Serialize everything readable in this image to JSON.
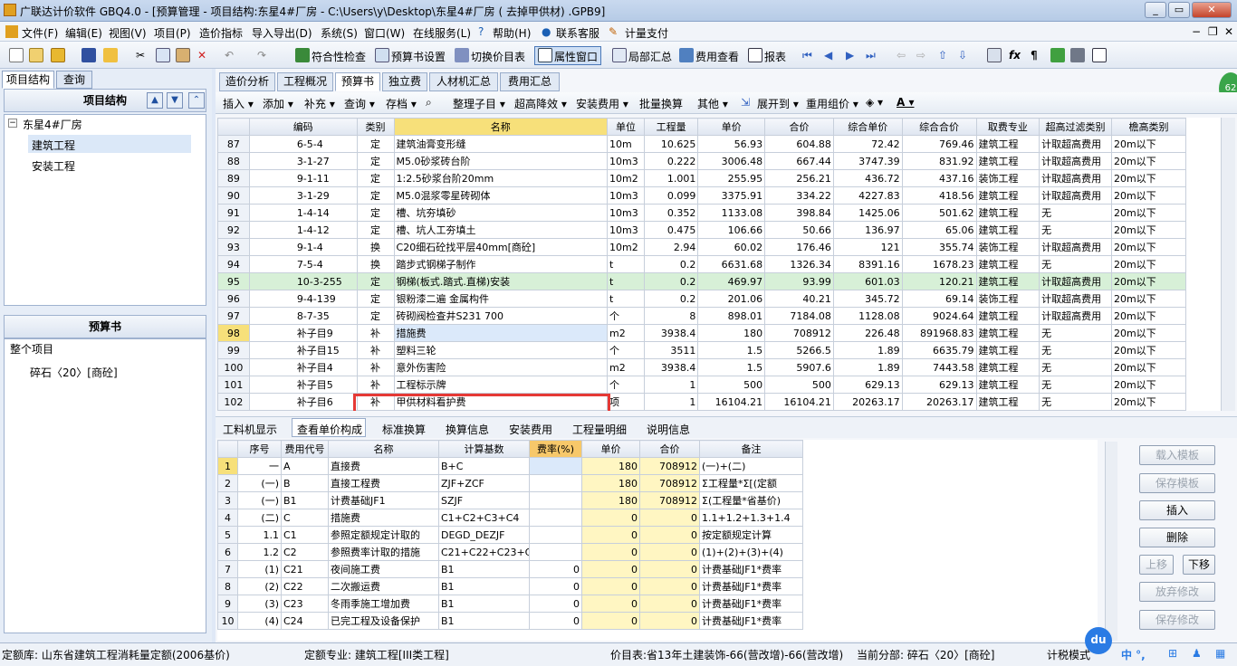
{
  "window": {
    "title": "广联达计价软件 GBQ4.0 - [预算管理 - 项目结构:东星4#厂房 - C:\\Users\\y\\Desktop\\东星4#厂房 ( 去掉甲供材) .GPB9]"
  },
  "menu": [
    "文件(F)",
    "编辑(E)",
    "视图(V)",
    "项目(P)",
    "造价指标",
    "导入导出(D)",
    "系统(S)",
    "窗口(W)",
    "在线服务(L)",
    "帮助(H)",
    "联系客服",
    "计量支付"
  ],
  "toolbar": {
    "check": "符合性检查",
    "budget_settings": "预算书设置",
    "switch_price": "切换价目表",
    "property_window": "属性窗口",
    "local_summary": "局部汇总",
    "fee_view": "费用查看",
    "report": "报表"
  },
  "left": {
    "tabs": [
      "项目结构",
      "查询"
    ],
    "structure_title": "项目结构",
    "tree": [
      "东星4#厂房",
      "建筑工程",
      "安装工程"
    ],
    "budget_title": "预算书",
    "budget_tree": [
      "整个项目",
      "碎石〈20〉[商砼]"
    ]
  },
  "main": {
    "tabs": [
      "造价分析",
      "工程概况",
      "预算书",
      "独立费",
      "人材机汇总",
      "费用汇总"
    ],
    "subtoolbar": [
      "插入",
      "添加",
      "补充",
      "查询",
      "存档",
      "整理子目",
      "超高降效",
      "安装费用",
      "批量换算",
      "其他",
      "展开到",
      "重用组价"
    ],
    "headers": [
      "编码",
      "类别",
      "名称",
      "单位",
      "工程量",
      "单价",
      "合价",
      "综合单价",
      "综合合价",
      "取费专业",
      "超高过滤类别",
      "檐高类别"
    ],
    "rows": [
      [
        "87",
        "6-5-4",
        "定",
        "建筑油膏变形缝",
        "10m",
        "10.625",
        "56.93",
        "604.88",
        "72.42",
        "769.46",
        "建筑工程",
        "计取超高费用",
        "20m以下"
      ],
      [
        "88",
        "3-1-27",
        "定",
        "M5.0砂浆砖台阶",
        "10m3",
        "0.222",
        "3006.48",
        "667.44",
        "3747.39",
        "831.92",
        "建筑工程",
        "计取超高费用",
        "20m以下"
      ],
      [
        "89",
        "9-1-11",
        "定",
        "1:2.5砂浆台阶20mm",
        "10m2",
        "1.001",
        "255.95",
        "256.21",
        "436.72",
        "437.16",
        "装饰工程",
        "计取超高费用",
        "20m以下"
      ],
      [
        "90",
        "3-1-29",
        "定",
        "M5.0混浆零星砖砌体",
        "10m3",
        "0.099",
        "3375.91",
        "334.22",
        "4227.83",
        "418.56",
        "建筑工程",
        "计取超高费用",
        "20m以下"
      ],
      [
        "91",
        "1-4-14",
        "定",
        "槽、坑夯填砂",
        "10m3",
        "0.352",
        "1133.08",
        "398.84",
        "1425.06",
        "501.62",
        "建筑工程",
        "无",
        "20m以下"
      ],
      [
        "92",
        "1-4-12",
        "定",
        "槽、坑人工夯填土",
        "10m3",
        "0.475",
        "106.66",
        "50.66",
        "136.97",
        "65.06",
        "建筑工程",
        "无",
        "20m以下"
      ],
      [
        "93",
        "9-1-4",
        "换",
        "C20细石砼找平层40mm[商砼]",
        "10m2",
        "2.94",
        "60.02",
        "176.46",
        "121",
        "355.74",
        "装饰工程",
        "计取超高费用",
        "20m以下"
      ],
      [
        "94",
        "7-5-4",
        "换",
        "踏步式钢梯子制作",
        "t",
        "0.2",
        "6631.68",
        "1326.34",
        "8391.16",
        "1678.23",
        "建筑工程",
        "无",
        "20m以下"
      ],
      [
        "95",
        "10-3-255",
        "定",
        "钢梯(板式.踏式.直梯)安装",
        "t",
        "0.2",
        "469.97",
        "93.99",
        "601.03",
        "120.21",
        "建筑工程",
        "计取超高费用",
        "20m以下"
      ],
      [
        "96",
        "9-4-139",
        "定",
        "银粉漆二遍 金属构件",
        "t",
        "0.2",
        "201.06",
        "40.21",
        "345.72",
        "69.14",
        "装饰工程",
        "计取超高费用",
        "20m以下"
      ],
      [
        "97",
        "8-7-35",
        "定",
        "砖砌阀检查井S231 700",
        "个",
        "8",
        "898.01",
        "7184.08",
        "1128.08",
        "9024.64",
        "建筑工程",
        "计取超高费用",
        "20m以下"
      ],
      [
        "98",
        "补子目9",
        "补",
        "措施费",
        "m2",
        "3938.4",
        "180",
        "708912",
        "226.48",
        "891968.83",
        "建筑工程",
        "无",
        "20m以下"
      ],
      [
        "99",
        "补子目15",
        "补",
        "塑料三轮",
        "个",
        "3511",
        "1.5",
        "5266.5",
        "1.89",
        "6635.79",
        "建筑工程",
        "无",
        "20m以下"
      ],
      [
        "100",
        "补子目4",
        "补",
        "意外伤害险",
        "m2",
        "3938.4",
        "1.5",
        "5907.6",
        "1.89",
        "7443.58",
        "建筑工程",
        "无",
        "20m以下"
      ],
      [
        "101",
        "补子目5",
        "补",
        "工程标示牌",
        "个",
        "1",
        "500",
        "500",
        "629.13",
        "629.13",
        "建筑工程",
        "无",
        "20m以下"
      ],
      [
        "102",
        "补子目6",
        "补",
        "甲供材料看护费",
        "项",
        "1",
        "16104.21",
        "16104.21",
        "20263.17",
        "20263.17",
        "建筑工程",
        "无",
        "20m以下"
      ]
    ],
    "bottom_tabs": [
      "工料机显示",
      "查看单价构成",
      "标准换算",
      "换算信息",
      "安装费用",
      "工程量明细",
      "说明信息"
    ],
    "cost_headers": [
      "序号",
      "费用代号",
      "名称",
      "计算基数",
      "费率(%)",
      "单价",
      "合价",
      "备注"
    ],
    "cost_rows": [
      [
        "1",
        "一",
        "A",
        "直接费",
        "B+C",
        "",
        "180",
        "708912",
        "(一)+(二)"
      ],
      [
        "2",
        "(一)",
        "B",
        "直接工程费",
        "ZJF+ZCF",
        "",
        "180",
        "708912",
        "Σ工程量*Σ[(定额"
      ],
      [
        "3",
        "(一)",
        "B1",
        "计费基础JF1",
        "SZJF",
        "",
        "180",
        "708912",
        "Σ(工程量*省基价)"
      ],
      [
        "4",
        "(二)",
        "C",
        "措施费",
        "C1+C2+C3+C4",
        "",
        "0",
        "0",
        "1.1+1.2+1.3+1.4"
      ],
      [
        "5",
        "1.1",
        "C1",
        "参照定额规定计取的",
        "DEGD_DEZJF",
        "",
        "0",
        "0",
        "按定额规定计算"
      ],
      [
        "6",
        "1.2",
        "C2",
        "参照费率计取的措施",
        "C21+C22+C23+C24",
        "",
        "0",
        "0",
        "(1)+(2)+(3)+(4)"
      ],
      [
        "7",
        "(1)",
        "C21",
        "夜间施工费",
        "B1",
        "0",
        "0",
        "0",
        "计费基础JF1*费率"
      ],
      [
        "8",
        "(2)",
        "C22",
        "二次搬运费",
        "B1",
        "0",
        "0",
        "0",
        "计费基础JF1*费率"
      ],
      [
        "9",
        "(3)",
        "C23",
        "冬雨季施工增加费",
        "B1",
        "0",
        "0",
        "0",
        "计费基础JF1*费率"
      ],
      [
        "10",
        "(4)",
        "C24",
        "已完工程及设备保护",
        "B1",
        "0",
        "0",
        "0",
        "计费基础JF1*费率"
      ]
    ],
    "side_buttons": [
      "载入模板",
      "保存模板",
      "插入",
      "删除",
      "上移",
      "下移",
      "放弃修改",
      "保存修改"
    ]
  },
  "status": {
    "quota_lib": "定额库: 山东省建筑工程消耗量定额(2006基价)",
    "quota_major": "定额专业: 建筑工程[III类工程]",
    "price_table": "价目表:省13年土建装饰-66(营改增)-66(营改增)",
    "current_part": "当前分部: 碎石〈20〉[商砼]",
    "tax": "计税模式"
  },
  "colors": {
    "highlight_row": "#d7f0d7",
    "selection_box": "#e53935",
    "yellow_cells": "#fff6c2"
  }
}
